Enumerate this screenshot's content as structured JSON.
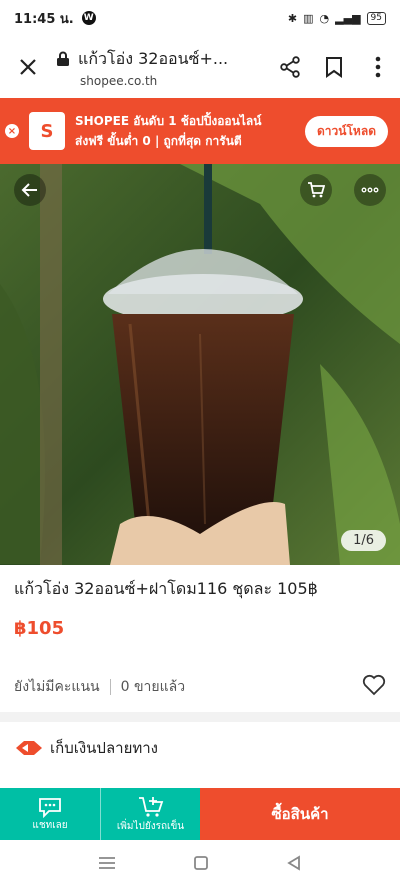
{
  "status": {
    "time": "11:45 น.",
    "app_badge": "W",
    "battery": "95"
  },
  "urlbar": {
    "title": "แก้วโอ่ง 32ออนซ์+...",
    "domain": "shopee.co.th"
  },
  "banner": {
    "line1": "SHOPEE อันดับ 1 ช้อปปิ้งออนไลน์",
    "line2": "ส่งฟรี ขั้นต่ำ 0 | ถูกที่สุด การันตี",
    "download": "ดาวน์โหลด",
    "brand_color": "#ee4d2d"
  },
  "hero": {
    "counter": "1/6"
  },
  "product": {
    "title": "แก้วโอ่ง 32ออนซ์+ฝาโดม116 ชุดละ 105฿",
    "price": "฿105",
    "rating_text": "ยังไม่มีคะแนน",
    "sold_text": "0 ขายแล้ว"
  },
  "cod": {
    "label": "เก็บเงินปลายทาง"
  },
  "bottom": {
    "chat": "แชทเลย",
    "cart": "เพิ่มไปยังรถเข็น",
    "buy": "ซื้อสินค้า",
    "teal": "#00bfa5"
  }
}
